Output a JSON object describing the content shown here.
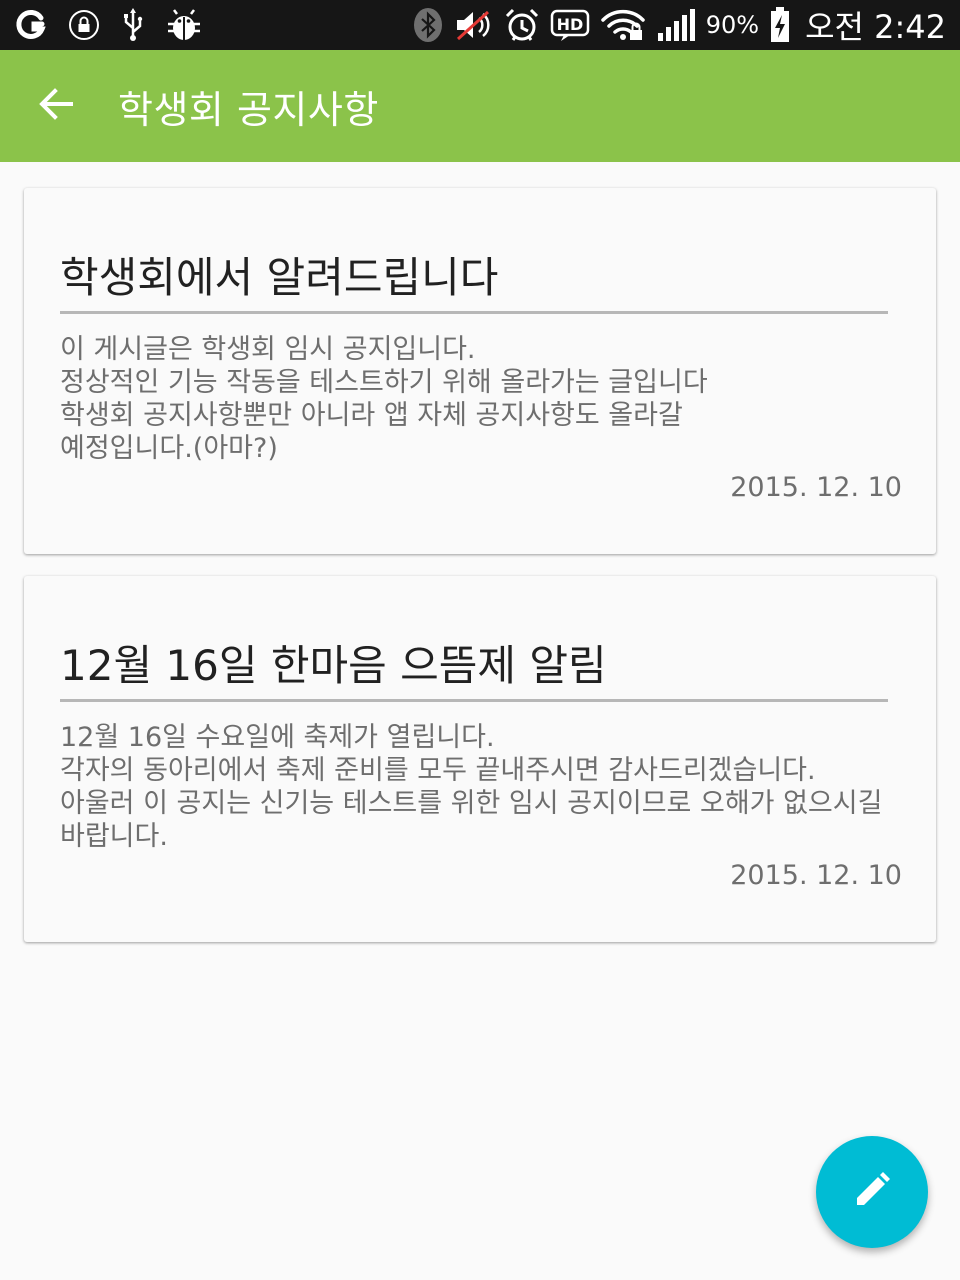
{
  "status_bar": {
    "icons_left": [
      "olleh-icon",
      "lock-icon",
      "usb-icon",
      "android-debug-icon"
    ],
    "icons_right": [
      "bluetooth-icon",
      "mute-icon",
      "alarm-icon",
      "hd-icon",
      "wifi-icon",
      "signal-icon"
    ],
    "battery_percent": "90%",
    "time": "오전 2:42"
  },
  "app_bar": {
    "title": "학생회 공지사항",
    "back_icon": "arrow-left-icon",
    "background_color": "#8bc34a"
  },
  "notices": [
    {
      "title": "학생회에서 알려드립니다",
      "body": "이 게시글은 학생회 임시 공지입니다.\n정상적인 기능 작동을 테스트하기 위해 올라가는 글입니다\n학생회 공지사항뿐만 아니라 앱 자체 공지사항도 올라갈\n예정입니다.(아마?)",
      "date": "2015. 12. 10"
    },
    {
      "title": "12월 16일 한마음 으뜸제 알림",
      "body": "12월 16일 수요일에 축제가 열립니다.\n각자의 동아리에서 축제 준비를 모두 끝내주시면 감사드리겠습니다.\n아울러 이 공지는 신기능 테스트를 위한 임시 공지이므로 오해가 없으시길\n바랍니다.",
      "date": "2015. 12. 10"
    }
  ],
  "fab": {
    "icon": "pencil-edit-icon",
    "color": "#00bcd4"
  }
}
